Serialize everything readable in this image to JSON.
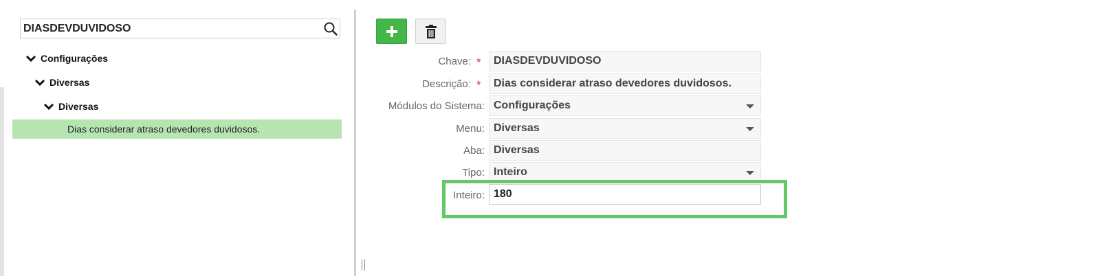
{
  "search": {
    "value": "DIASDEVDUVIDOSO",
    "icon": "search-icon"
  },
  "tree": {
    "level1": "Configurações",
    "level2": "Diversas",
    "level3": "Diversas",
    "selected_leaf": "Dias considerar atraso devedores duvidosos."
  },
  "toolbar": {
    "add_icon": "plus-icon",
    "delete_icon": "trash-icon"
  },
  "form": {
    "chave": {
      "label": "Chave:",
      "value": "DIASDEVDUVIDOSO",
      "required": "*"
    },
    "descricao": {
      "label": "Descrição:",
      "value": "Dias considerar atraso devedores duvidosos.",
      "required": "*"
    },
    "modulos": {
      "label": "Módulos do Sistema:",
      "value": "Configurações"
    },
    "menu": {
      "label": "Menu:",
      "value": "Diversas"
    },
    "aba": {
      "label": "Aba:",
      "value": "Diversas"
    },
    "tipo": {
      "label": "Tipo:",
      "value": "Inteiro"
    },
    "inteiro": {
      "label": "Inteiro:",
      "value": "180"
    }
  },
  "colors": {
    "accent_green": "#43b749",
    "selected_row": "#b6e5b2",
    "highlight": "#63c865",
    "required": "#d0342c"
  }
}
